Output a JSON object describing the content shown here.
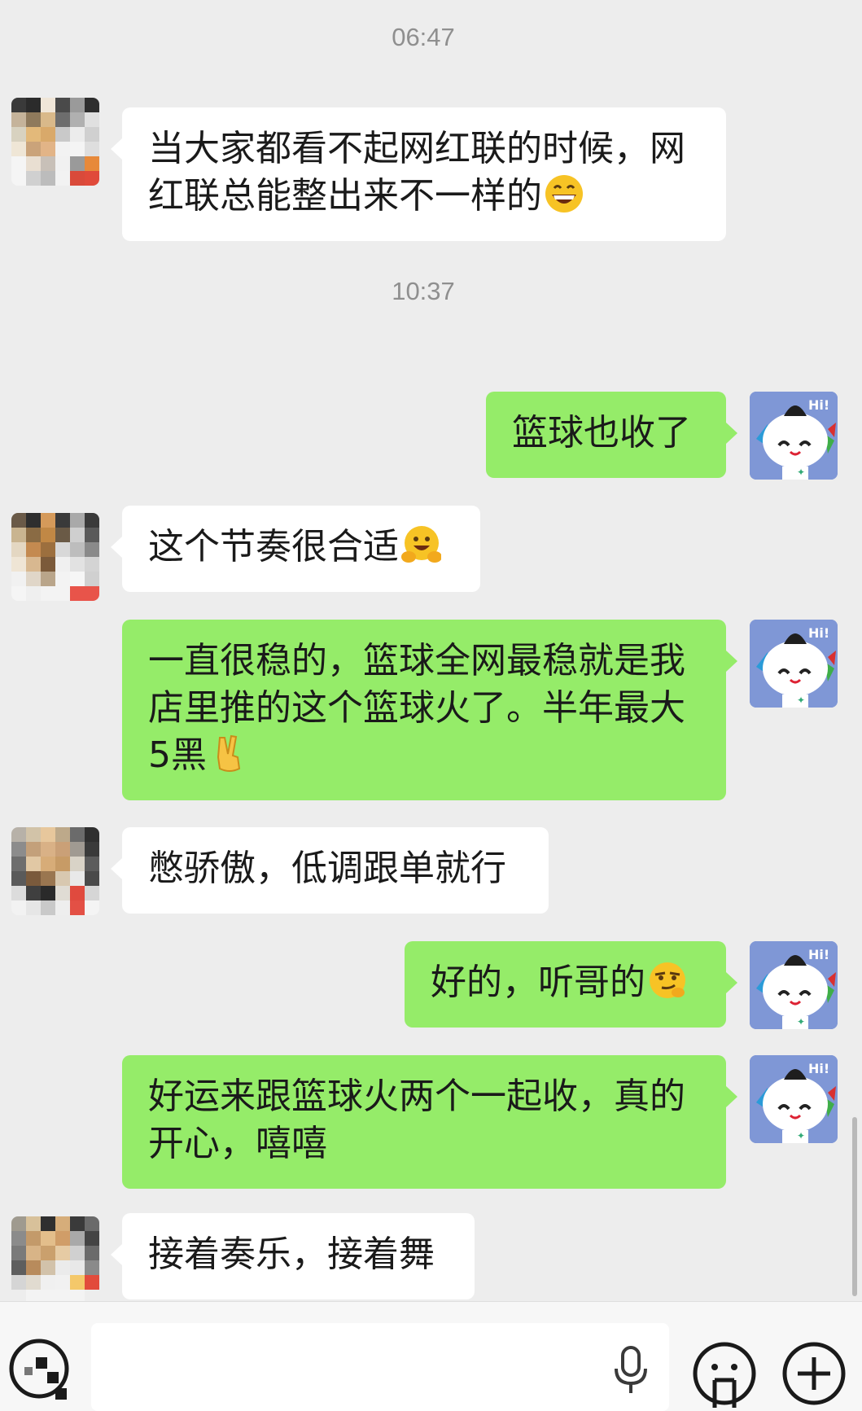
{
  "timestamps": [
    "06:47",
    "10:37"
  ],
  "messages": [
    {
      "side": "in",
      "lines": [
        "当大家都看不起网红联的时候，网",
        "红联总能整出来不一样的"
      ],
      "emoji": "grin-face-icon"
    },
    {
      "side": "out",
      "lines": [
        "篮球也收了"
      ],
      "emoji": ""
    },
    {
      "side": "in",
      "lines": [
        "这个节奏很合适"
      ],
      "emoji": "hugging-face-icon"
    },
    {
      "side": "out",
      "lines": [
        "一直很稳的，篮球全网最稳就是我",
        "店里推的这个篮球火了。半年最大",
        "5黑"
      ],
      "emoji": "victory-hand-icon"
    },
    {
      "side": "in",
      "lines": [
        "憋骄傲，低调跟单就行"
      ],
      "emoji": ""
    },
    {
      "side": "out",
      "lines": [
        "好的，听哥的"
      ],
      "emoji": "smirk-face-icon"
    },
    {
      "side": "out",
      "lines": [
        "好运来跟篮球火两个一起收，真的",
        "开心，嘻嘻"
      ],
      "emoji": ""
    },
    {
      "side": "in",
      "lines": [
        "接着奏乐，接着舞"
      ],
      "emoji": ""
    }
  ],
  "self_avatar": {
    "badge": "Hi!",
    "color": "#7f97d6"
  },
  "colors": {
    "incoming_bubble": "#ffffff",
    "outgoing_bubble": "#95ec69",
    "background": "#ededed"
  },
  "input_bar": {
    "left_icon": "voice-toggle-icon",
    "mic_icon": "microphone-icon",
    "emoji_icon": "emoji-face-icon",
    "plus_icon": "plus-icon",
    "placeholder": ""
  }
}
